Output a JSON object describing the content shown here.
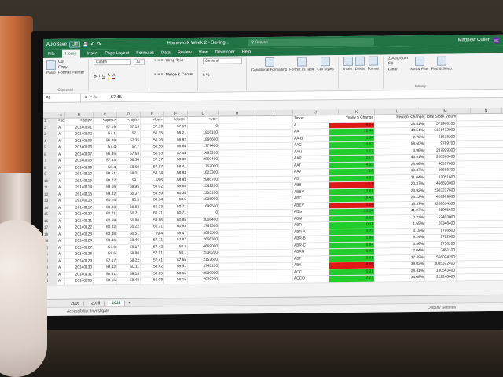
{
  "excel": {
    "autosave": "AutoSave",
    "autosave_state": "Off",
    "title": "Homework Week 2 - Saving...",
    "search_placeholder": "Search",
    "user": "Matthew Cullen",
    "user_initials": "MC",
    "tabs": [
      "File",
      "Home",
      "Insert",
      "Page Layout",
      "Formulas",
      "Data",
      "Review",
      "View",
      "Developer",
      "Help"
    ],
    "active_tab": "Home",
    "ribbon": {
      "clipboard_label": "Clipboard",
      "paste": "Paste",
      "cut": "Cut",
      "copy": "Copy",
      "format_painter": "Format Painter",
      "font_name": "Calibri",
      "font_size": "12",
      "wrap_text": "Wrap Text",
      "merge_center": "Merge & Center",
      "number_format": "General",
      "conditional_formatting": "Conditional Formatting",
      "format_as_table": "Format as Table",
      "cell_styles": "Cell Styles",
      "insert": "Insert",
      "delete": "Delete",
      "format": "Format",
      "autosum": "AutoSum",
      "fill": "Fill",
      "clear": "Clear",
      "sort_filter": "Sort & Filter",
      "find_select": "Find & Select",
      "editing_label": "Editing"
    },
    "name_box": "F6",
    "formula_value": "57.45",
    "columns": [
      "A",
      "B",
      "C",
      "D",
      "E",
      "F",
      "G",
      "H",
      "I",
      "J",
      "K",
      "L",
      "M",
      "N"
    ],
    "header_row": [
      "<ticker>",
      "<date>",
      "<open>",
      "<high>",
      "<low>",
      "<close>",
      "<vol>"
    ],
    "rows": [
      [
        "A",
        "20140101",
        "57.19",
        "57.19",
        "57.19",
        "57.19",
        "0"
      ],
      [
        "A",
        "20140102",
        "57.1",
        "57.1",
        "56.15",
        "56.21",
        "1916100"
      ],
      [
        "A",
        "20140103",
        "56.39",
        "57.35",
        "56.26",
        "56.92",
        "1866600"
      ],
      [
        "A",
        "20140106",
        "57.4",
        "57.7",
        "56.56",
        "56.64",
        "1777400"
      ],
      [
        "A",
        "20140107",
        "56.95",
        "57.63",
        "56.93",
        "57.45",
        "1463200"
      ],
      [
        "A",
        "20140108",
        "57.33",
        "58.54",
        "57.17",
        "58.39",
        "2659400"
      ],
      [
        "A",
        "20140109",
        "58.4",
        "58.68",
        "57.87",
        "58.41",
        "1757000"
      ],
      [
        "A",
        "20140110",
        "58.51",
        "59.01",
        "58.14",
        "58.93",
        "1623300"
      ],
      [
        "A",
        "20140113",
        "58.77",
        "59.1",
        "58.6",
        "58.93",
        "2946700"
      ],
      [
        "A",
        "20140114",
        "59.16",
        "59.95",
        "59.02",
        "59.88",
        "2562200"
      ],
      [
        "A",
        "20140115",
        "59.82",
        "60.37",
        "59.59",
        "60.34",
        "2335100"
      ],
      [
        "A",
        "20140116",
        "60.24",
        "60.5",
        "60.04",
        "60.5",
        "1835900"
      ],
      [
        "A",
        "20140117",
        "60.83",
        "60.83",
        "60.33",
        "60.71",
        "1699500"
      ],
      [
        "A",
        "20140120",
        "60.71",
        "60.71",
        "60.71",
        "60.71",
        "0"
      ],
      [
        "A",
        "20140121",
        "60.69",
        "60.88",
        "59.86",
        "60.85",
        "3008400"
      ],
      [
        "A",
        "20140122",
        "60.82",
        "61.22",
        "60.71",
        "60.93",
        "2769300"
      ],
      [
        "A",
        "20140123",
        "60.48",
        "60.51",
        "59.4",
        "59.47",
        "3063500"
      ],
      [
        "A",
        "20140124",
        "59.46",
        "59.46",
        "57.71",
        "57.87",
        "2656300"
      ],
      [
        "A",
        "20140127",
        "57.9",
        "58.17",
        "57.42",
        "58.3",
        "4669000"
      ],
      [
        "A",
        "20140128",
        "58.5",
        "58.88",
        "57.91",
        "58.1",
        "2536200"
      ],
      [
        "A",
        "20140129",
        "57.67",
        "58.22",
        "57.41",
        "57.65",
        "2153600"
      ],
      [
        "A",
        "20140130",
        "58.42",
        "60.11",
        "58.42",
        "59.51",
        "3743100"
      ],
      [
        "A",
        "20140131",
        "58.61",
        "59.15",
        "58.05",
        "58.15",
        "3529000"
      ],
      [
        "A",
        "20140203",
        "58.15",
        "58.48",
        "56.08",
        "56.15",
        "2929200"
      ]
    ],
    "summary_header": [
      "Ticker",
      "Yearly $ Change",
      "Percent Change",
      "Total Stock Volume"
    ],
    "summary": [
      [
        "A",
        "-6.07",
        "28.41%",
        "572978100",
        "neg"
      ],
      [
        "AA",
        "15.44",
        "48.54%",
        "5161412000",
        "pos"
      ],
      [
        "AA-B",
        "1.34",
        "2.73%",
        "21618200",
        "pos"
      ],
      [
        "AAC",
        "10.02",
        "58.60%",
        "9789700",
        "pos"
      ],
      [
        "AAN",
        "1.17",
        "3.98%",
        "237929300",
        "pos"
      ],
      [
        "AAP",
        "19.5",
        "43.91%",
        "200376400",
        "pos"
      ],
      [
        "AAT",
        "4.33",
        "26.66%",
        "40207800",
        "pos"
      ],
      [
        "AAV",
        "3.6",
        "10.37%",
        "86658700",
        "pos"
      ],
      [
        "AB",
        "4.97",
        "21.04%",
        "83051600",
        "pos"
      ],
      [
        "ABB",
        "-5.1",
        "20.37%",
        "466820000",
        "neg"
      ],
      [
        "ABBV",
        "12.61",
        "23.92%",
        "2303237600",
        "pos"
      ],
      [
        "ABC",
        "16.45",
        "28.23%",
        "428969000",
        "pos"
      ],
      [
        "ABEV",
        "-1.15",
        "15.37%",
        "3208014300",
        "neg"
      ],
      [
        "ABG",
        "22.14",
        "41.27%",
        "81065600",
        "pos"
      ],
      [
        "ABM",
        "0.06",
        "0.21%",
        "52403000",
        "pos"
      ],
      [
        "ABR",
        "0.11",
        "1.65%",
        "28348400",
        "pos"
      ],
      [
        "ABR-A",
        "0.77",
        "3.18%",
        "1798500",
        "pos"
      ],
      [
        "ABR-B",
        "1.99",
        "9.24%",
        "1722000",
        "pos"
      ],
      [
        "ABR-C",
        "0.94",
        "3.86%",
        "1758200",
        "pos"
      ],
      [
        "ABRN",
        "0.48",
        "2.04%",
        "3451100",
        "pos"
      ],
      [
        "ABT",
        "9.41",
        "37.45%",
        "1556024200",
        "pos"
      ],
      [
        "ABX",
        "-8.95",
        "39.02%",
        "3085372400",
        "neg"
      ],
      [
        "ACC",
        "5.31",
        "28.41%",
        "180543400",
        "pos"
      ],
      [
        "ACCO",
        "2.27",
        "34.08%",
        "222248000",
        "pos"
      ]
    ],
    "sheets": [
      "2016",
      "2015",
      "2014"
    ],
    "active_sheet": "2014",
    "status": "Accessibility: Investigate",
    "display_settings": "Display Settings",
    "colors": {
      "excel_green": "#217346",
      "positive": "#22cc2c",
      "negative": "#e01818"
    }
  }
}
